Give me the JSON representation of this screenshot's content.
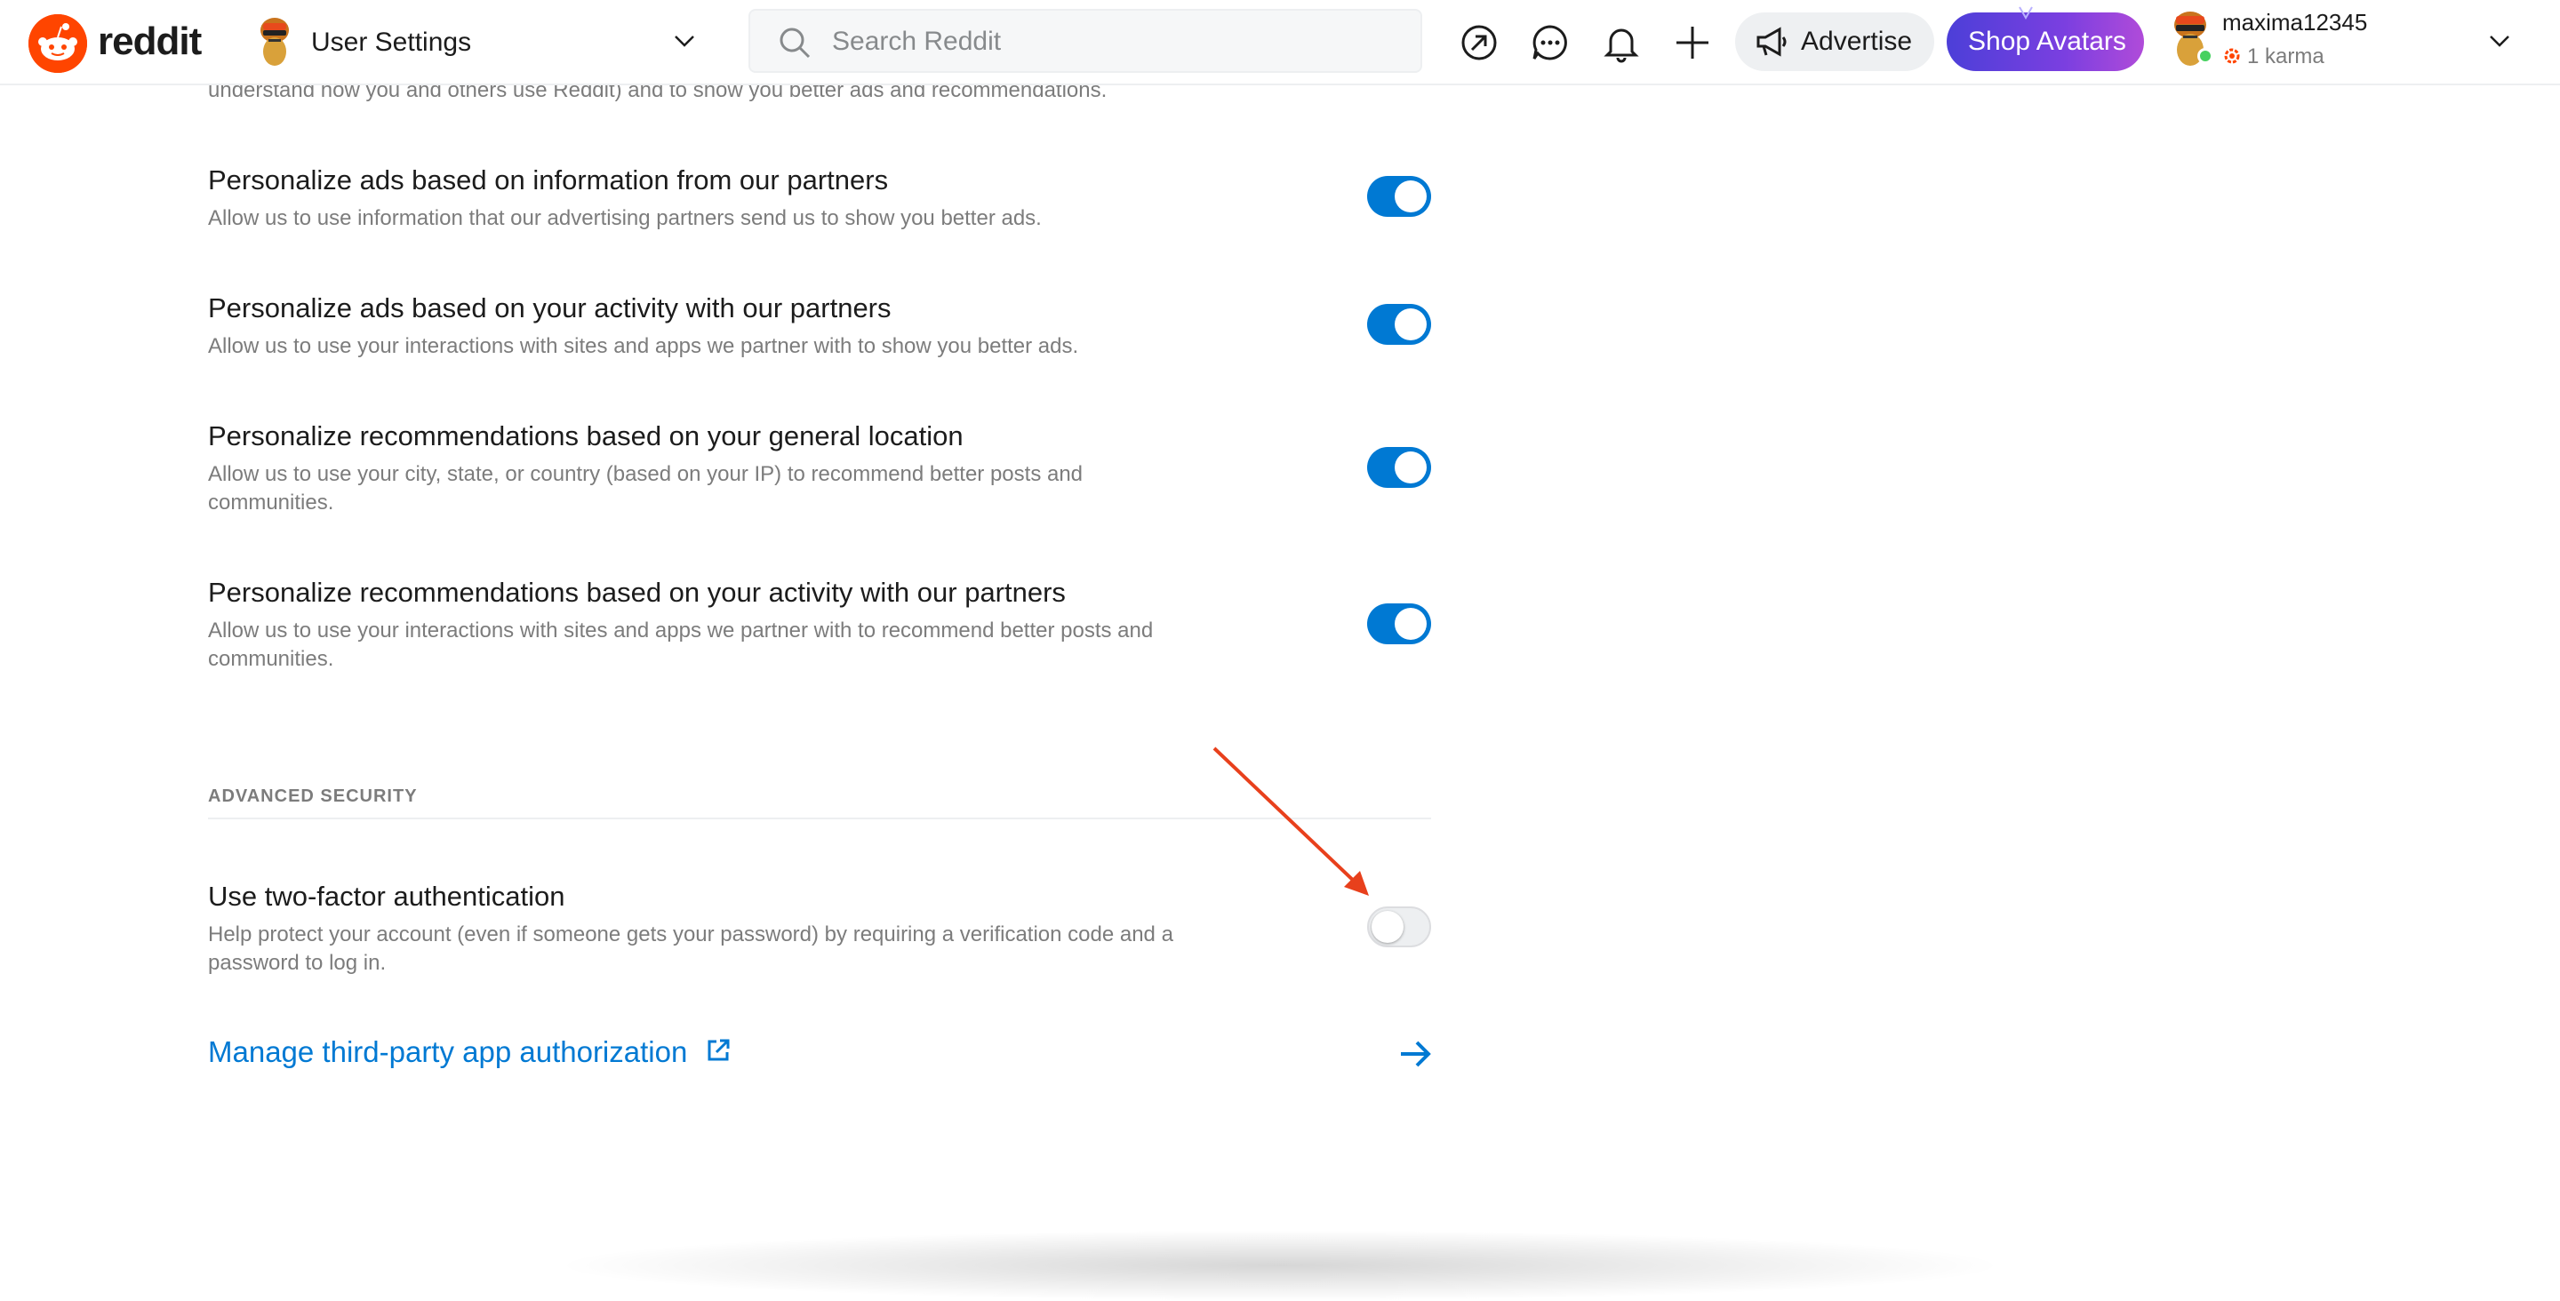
{
  "header": {
    "wordmark": "reddit",
    "page_title": "User Settings",
    "search_placeholder": "Search Reddit",
    "advertise_label": "Advertise",
    "shop_label": "Shop Avatars",
    "username": "maxima12345",
    "karma": "1 karma"
  },
  "settings": [
    {
      "cut_desc": "understand how you and others use Reddit) and to show you better ads and recommendations."
    },
    {
      "title": "Personalize ads based on information from our partners",
      "desc": "Allow us to use information that our advertising partners send us to show you better ads.",
      "enabled": true
    },
    {
      "title": "Personalize ads based on your activity with our partners",
      "desc": "Allow us to use your interactions with sites and apps we partner with to show you better ads.",
      "enabled": true
    },
    {
      "title": "Personalize recommendations based on your general location",
      "desc": "Allow us to use your city, state, or country (based on your IP) to recommend better posts and communities.",
      "enabled": true
    },
    {
      "title": "Personalize recommendations based on your activity with our partners",
      "desc": "Allow us to use your interactions with sites and apps we partner with to recommend better posts and communities.",
      "enabled": true
    }
  ],
  "advanced_security": {
    "heading": "ADVANCED SECURITY",
    "two_factor": {
      "title": "Use two-factor authentication",
      "desc": "Help protect your account (even if someone gets your password) by requiring a verification code and a password to log in.",
      "enabled": false
    },
    "manage_link": "Manage third-party app authorization"
  },
  "colors": {
    "brand": "#ff4500",
    "toggle_on": "#0079d3",
    "link": "#0079d3",
    "annotation_arrow": "#e8401c"
  }
}
